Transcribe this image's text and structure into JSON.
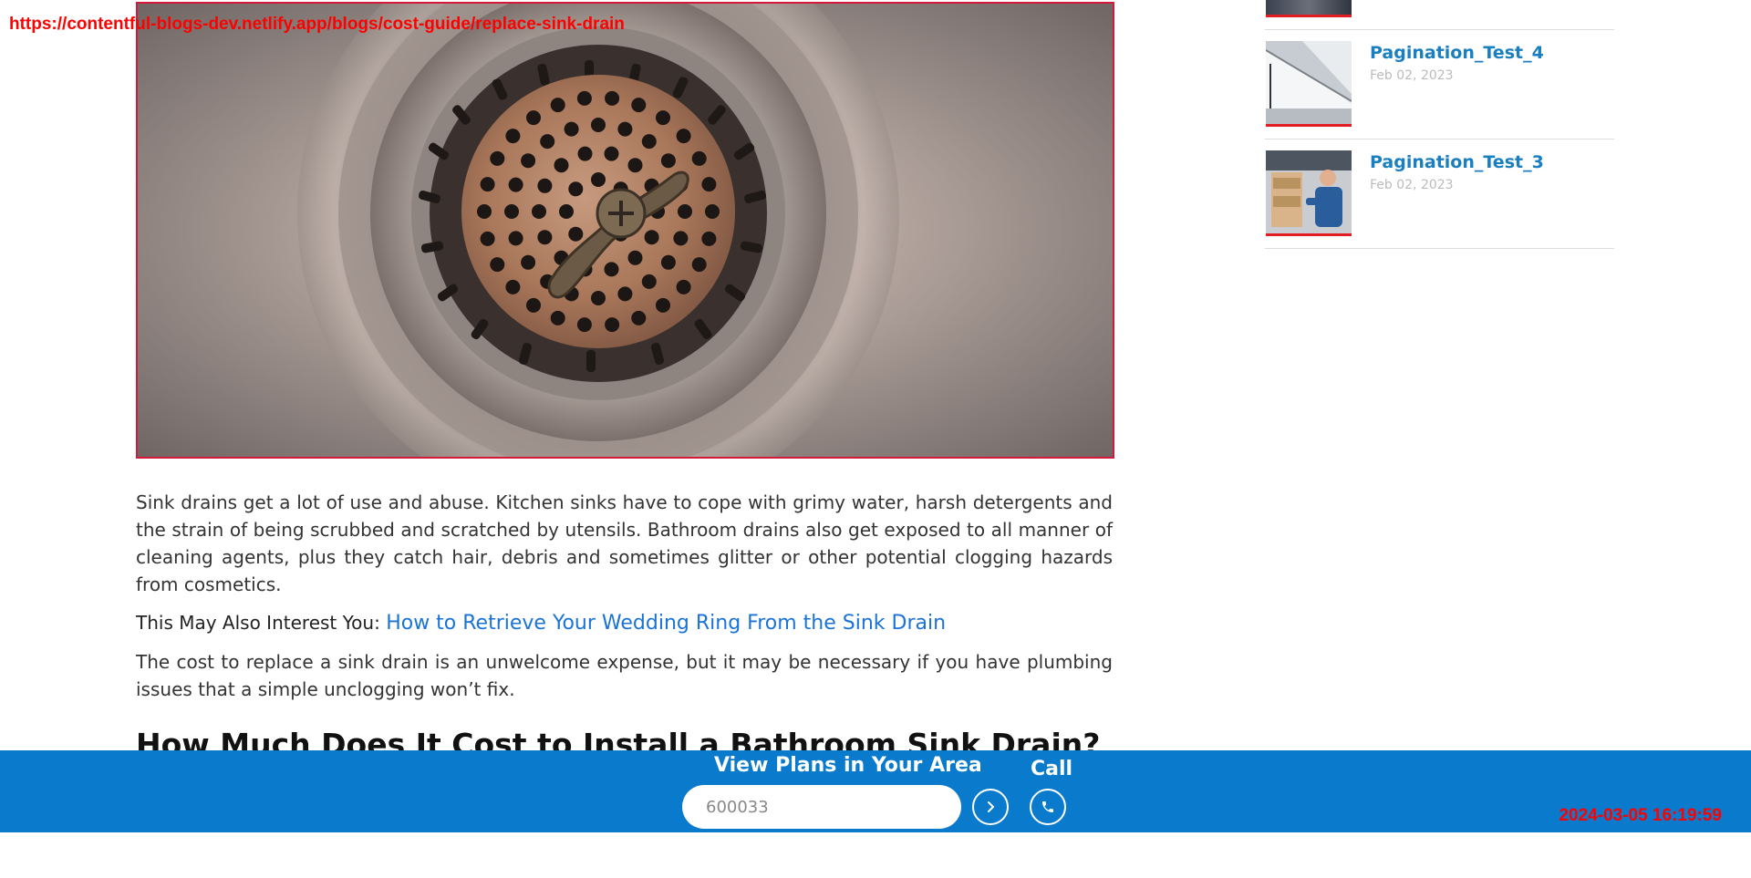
{
  "browser_overlay": {
    "url": "https://contentful-blogs-dev.netlify.app/blogs/cost-guide/replace-sink-drain",
    "timestamp": "2024-03-05 16:19:59"
  },
  "article": {
    "hero_alt": "Close-up of a stainless steel sink drain strainer",
    "paragraph_1": "Sink drains get a lot of use and abuse. Kitchen sinks have to cope with grimy water, harsh detergents and the strain of being scrubbed and scratched by utensils. Bathroom drains also get exposed to all manner of cleaning agents, plus they catch hair, debris and sometimes glitter or other potential clogging hazards from cosmetics.",
    "interest_label": "This May Also Interest You: ",
    "interest_link": "How to Retrieve Your Wedding Ring From the Sink Drain",
    "paragraph_2": "The cost to replace a sink drain is an unwelcome expense, but it may be necessary if you have plumbing issues that a simple unclogging won’t fix.",
    "heading": "How Much Does It Cost to Install a Bathroom Sink Drain?"
  },
  "sidebar": {
    "items": [
      {
        "title": "Pagination_Test_4",
        "date": "Feb 02, 2023"
      },
      {
        "title": "Pagination_Test_3",
        "date": "Feb 02, 2023"
      }
    ]
  },
  "cta_bar": {
    "title": "View Plans in Your Area",
    "zip_value": "",
    "zip_placeholder": "600033",
    "call_label": "Call",
    "go_icon": "chevron-right-icon",
    "call_icon": "phone-icon",
    "background_color": "#0a7acc"
  },
  "colors": {
    "link": "#1a73d9",
    "sidebar_title": "#1a7fc1",
    "thumb_accent": "#e31b23",
    "overlay_text": "#ff0000"
  }
}
